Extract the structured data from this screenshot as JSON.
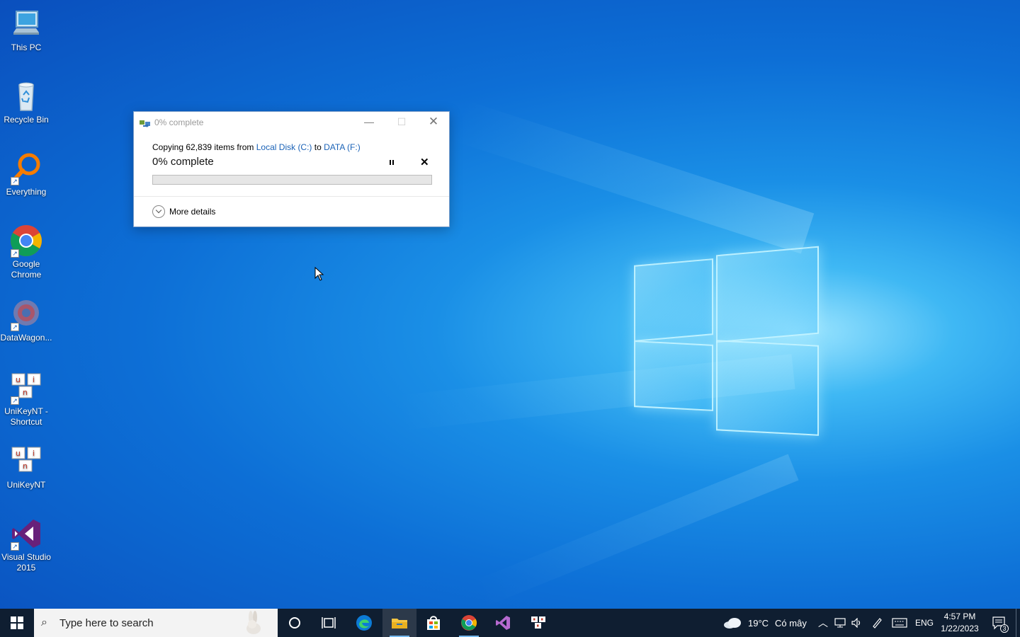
{
  "desktop": {
    "icons": [
      {
        "label": "This PC",
        "icon": "computer-icon"
      },
      {
        "label": "Recycle Bin",
        "icon": "recycle-bin-icon"
      },
      {
        "label": "Everything",
        "icon": "search-magnifier-icon"
      },
      {
        "label": "Google Chrome",
        "icon": "chrome-icon"
      },
      {
        "label": "DataWagon...",
        "icon": "datawagon-icon"
      },
      {
        "label": "UniKeyNT - Shortcut",
        "icon": "unikey-icon"
      },
      {
        "label": "UniKeyNT",
        "icon": "unikey-icon"
      },
      {
        "label": "Visual Studio 2015",
        "icon": "visual-studio-icon"
      }
    ]
  },
  "dialog": {
    "title": "0% complete",
    "copy_prefix": "Copying 62,839 items from",
    "source": "Local Disk (C:)",
    "copy_mid": "to",
    "destination": "DATA (F:)",
    "percent_label": "0% complete",
    "progress_fraction": 0.0,
    "more_details": "More details"
  },
  "taskbar": {
    "search_placeholder": "Type here to search",
    "pinned": [
      "cortana-icon",
      "task-view-icon",
      "edge-icon",
      "file-explorer-icon",
      "store-icon",
      "chrome-icon",
      "visual-studio-icon",
      "unikey-icon"
    ],
    "weather_temp": "19°C",
    "weather_text": "Có mây",
    "language": "ENG",
    "time": "4:57 PM",
    "date": "1/22/2023",
    "notification_count": "3"
  },
  "colors": {
    "taskbar_bg": "#0f1e31",
    "link": "#1a62b7",
    "progress_fill": "#06b025",
    "accent_underline": "#76b9ed"
  }
}
